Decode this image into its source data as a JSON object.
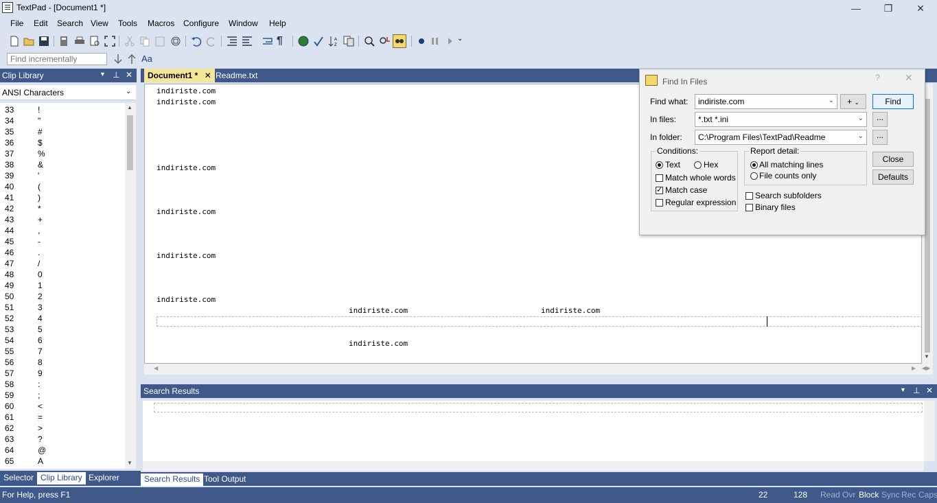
{
  "window": {
    "title": "TextPad - [Document1 *]",
    "minimize": "—",
    "restore": "❐",
    "close": "✕"
  },
  "menu": [
    "File",
    "Edit",
    "Search",
    "View",
    "Tools",
    "Macros",
    "Configure",
    "Window",
    "Help"
  ],
  "toolbar": {
    "find_incrementally_placeholder": "Find incrementally",
    "match_case_label": "Aa"
  },
  "clip_library": {
    "title": "Clip Library",
    "category": "ANSI Characters",
    "rows": [
      [
        "33",
        "!"
      ],
      [
        "34",
        "\""
      ],
      [
        "35",
        "#"
      ],
      [
        "36",
        "$"
      ],
      [
        "37",
        "%"
      ],
      [
        "38",
        "&"
      ],
      [
        "39",
        "'"
      ],
      [
        "40",
        "("
      ],
      [
        "41",
        ")"
      ],
      [
        "42",
        "*"
      ],
      [
        "43",
        "+"
      ],
      [
        "44",
        ","
      ],
      [
        "45",
        "-"
      ],
      [
        "46",
        "."
      ],
      [
        "47",
        "/"
      ],
      [
        "48",
        "0"
      ],
      [
        "49",
        "1"
      ],
      [
        "50",
        "2"
      ],
      [
        "51",
        "3"
      ],
      [
        "52",
        "4"
      ],
      [
        "53",
        "5"
      ],
      [
        "54",
        "6"
      ],
      [
        "55",
        "7"
      ],
      [
        "56",
        "8"
      ],
      [
        "57",
        "9"
      ],
      [
        "58",
        ":"
      ],
      [
        "59",
        ";"
      ],
      [
        "60",
        "<"
      ],
      [
        "61",
        "="
      ],
      [
        "62",
        ">"
      ],
      [
        "63",
        "?"
      ],
      [
        "64",
        "@"
      ],
      [
        "65",
        "A"
      ]
    ],
    "tabs": [
      "Selector",
      "Clip Library",
      "Explorer"
    ]
  },
  "documents": {
    "tabs": [
      "Document1 *",
      "Readme.txt"
    ],
    "lines": [
      "indiriste.com",
      "indiriste.com",
      "indiriste.com",
      "indiriste.com",
      "indiriste.com",
      "indiriste.com",
      "indiriste.com",
      "indiriste.com",
      "indiriste.com"
    ]
  },
  "search_results": {
    "title": "Search Results",
    "tabs": [
      "Search Results",
      "Tool Output"
    ]
  },
  "find_in_files": {
    "title": "Find In Files",
    "find_what_label": "Find what:",
    "find_what_value": "indiriste.com",
    "in_files_label": "In files:",
    "in_files_value": "*.txt *.ini",
    "in_folder_label": "In folder:",
    "in_folder_value": "C:\\Program Files\\TextPad\\Readme",
    "plus": "+",
    "browse": "...",
    "conditions_label": "Conditions:",
    "text_label": "Text",
    "hex_label": "Hex",
    "match_whole_words": "Match whole words",
    "match_case": "Match case",
    "regular_expression": "Regular expression",
    "report_detail_label": "Report detail:",
    "all_matching_lines": "All matching lines",
    "file_counts_only": "File counts only",
    "search_subfolders": "Search subfolders",
    "binary_files": "Binary files",
    "find_button": "Find",
    "close_button": "Close",
    "defaults_button": "Defaults",
    "help": "?",
    "close_x": "✕"
  },
  "status": {
    "help": "For Help, press F1",
    "line": "22",
    "col": "128",
    "read": "Read",
    "ovr": "Ovr",
    "block": "Block",
    "sync": "Sync",
    "rec": "Rec",
    "caps": "Caps"
  }
}
